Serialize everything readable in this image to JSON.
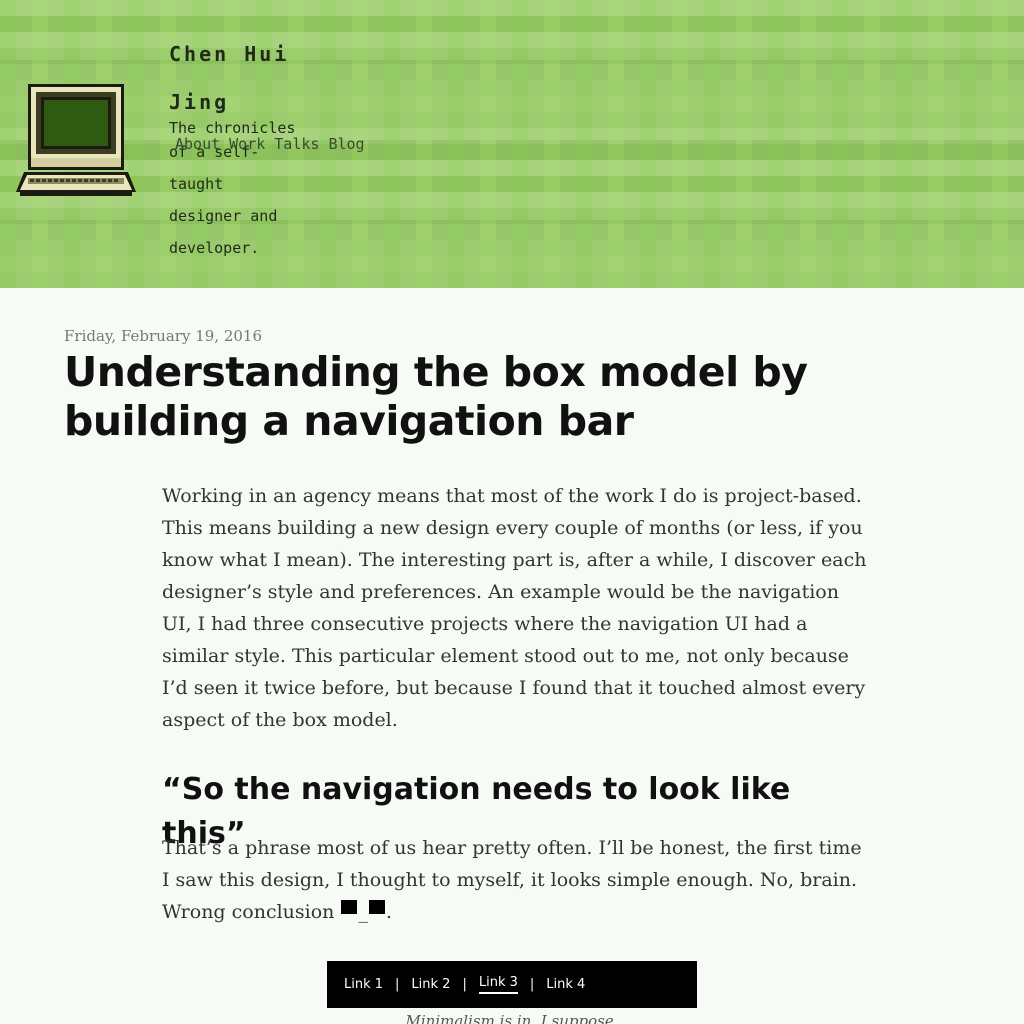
{
  "header": {
    "site_name": "Chen Hui Jing",
    "tagline_first": "The chronicles",
    "tagline_rest": "of a self-taught designer and developer.",
    "nav": [
      "About",
      "Work",
      "Talks",
      "Blog"
    ]
  },
  "post": {
    "date": "Friday, February 19, 2016",
    "title": "Understanding the box model by building a navigation bar",
    "paragraph1": "Working in an agency means that most of the work I do is project-based. This means building a new design every couple of months (or less, if you know what I mean). The interesting part is, after a while, I discover each designer’s style and preferences. An example would be the navigation UI, I had three consecutive projects where the navigation UI had a similar style. This particular element stood out to me, not only because I’d seen it twice before, but because I found that it touched almost every aspect of the box model.",
    "subheading": "“So the navigation needs to look like this”",
    "paragraph2_text": "That’s a phrase most of us hear pretty often. I’ll be honest, the first time I saw this design, I thought to myself, it looks simple enough. No, brain. Wrong conclusion",
    "emoticon_mid": "_",
    "paragraph2_end": "."
  },
  "demo": {
    "links": [
      "Link 1",
      "Link 2",
      "Link 3",
      "Link 4"
    ],
    "separator": "|",
    "active_index": 2,
    "caption": "Minimalism is in, I suppose."
  },
  "colors": {
    "header_green": "#a9d87a",
    "screen_green": "#2f5a12",
    "page_bg": "#f7fbf6"
  },
  "icons": {
    "logo": "retro-computer-icon"
  }
}
